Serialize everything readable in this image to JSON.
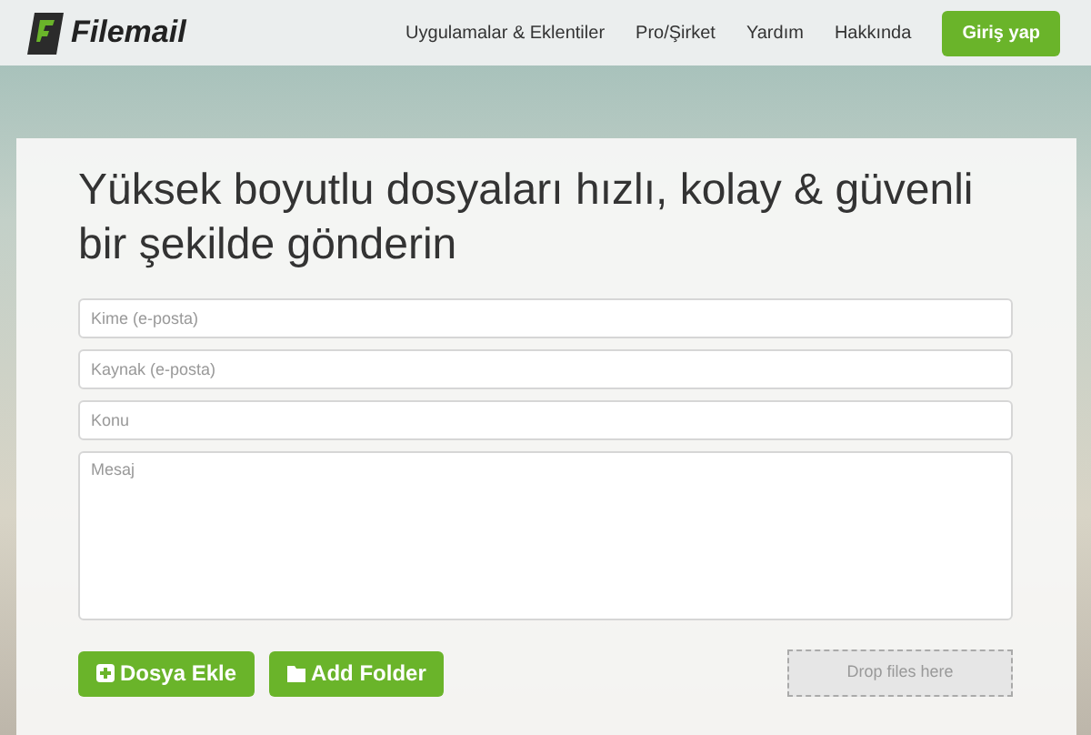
{
  "header": {
    "logo": "Filemail",
    "nav": [
      {
        "label": "Uygulamalar & Eklentiler"
      },
      {
        "label": "Pro/Şirket"
      },
      {
        "label": "Yardım"
      },
      {
        "label": "Hakkında"
      }
    ],
    "login_button": "Giriş yap"
  },
  "form": {
    "heading": "Yüksek boyutlu dosyaları hızlı, kolay & güvenli bir şekilde gönderin",
    "fields": [
      {
        "kind": "input",
        "placeholder": "Kime (e-posta)"
      },
      {
        "kind": "input",
        "placeholder": "Kaynak (e-posta)"
      },
      {
        "kind": "input",
        "placeholder": "Konu"
      },
      {
        "kind": "textarea",
        "placeholder": "Mesaj"
      }
    ],
    "buttons": [
      {
        "kind": "add-file",
        "label": "Dosya Ekle"
      },
      {
        "kind": "add-folder",
        "label": "Add Folder"
      }
    ],
    "drop_zone": "Drop files here"
  }
}
